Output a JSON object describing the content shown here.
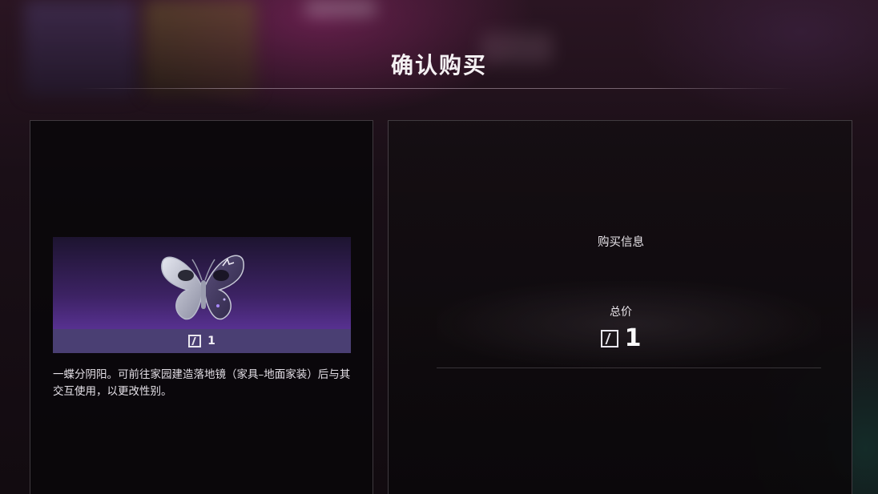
{
  "dialog": {
    "title": "确认购买"
  },
  "item": {
    "icon": "butterfly-mask-icon",
    "price": "1",
    "currency_icon": "currency-icon",
    "description": "一蝶分阴阳。可前往家园建造落地镜（家具–地面家装）后与其交互使用，以更改性别。"
  },
  "purchase_info": {
    "label": "购买信息",
    "total_label": "总价",
    "total_value": "1",
    "currency_icon": "currency-icon"
  },
  "colors": {
    "card_gradient_top": "#1d1430",
    "card_gradient_bottom": "#6a3bb0",
    "card_footer": "#4a3f73"
  }
}
